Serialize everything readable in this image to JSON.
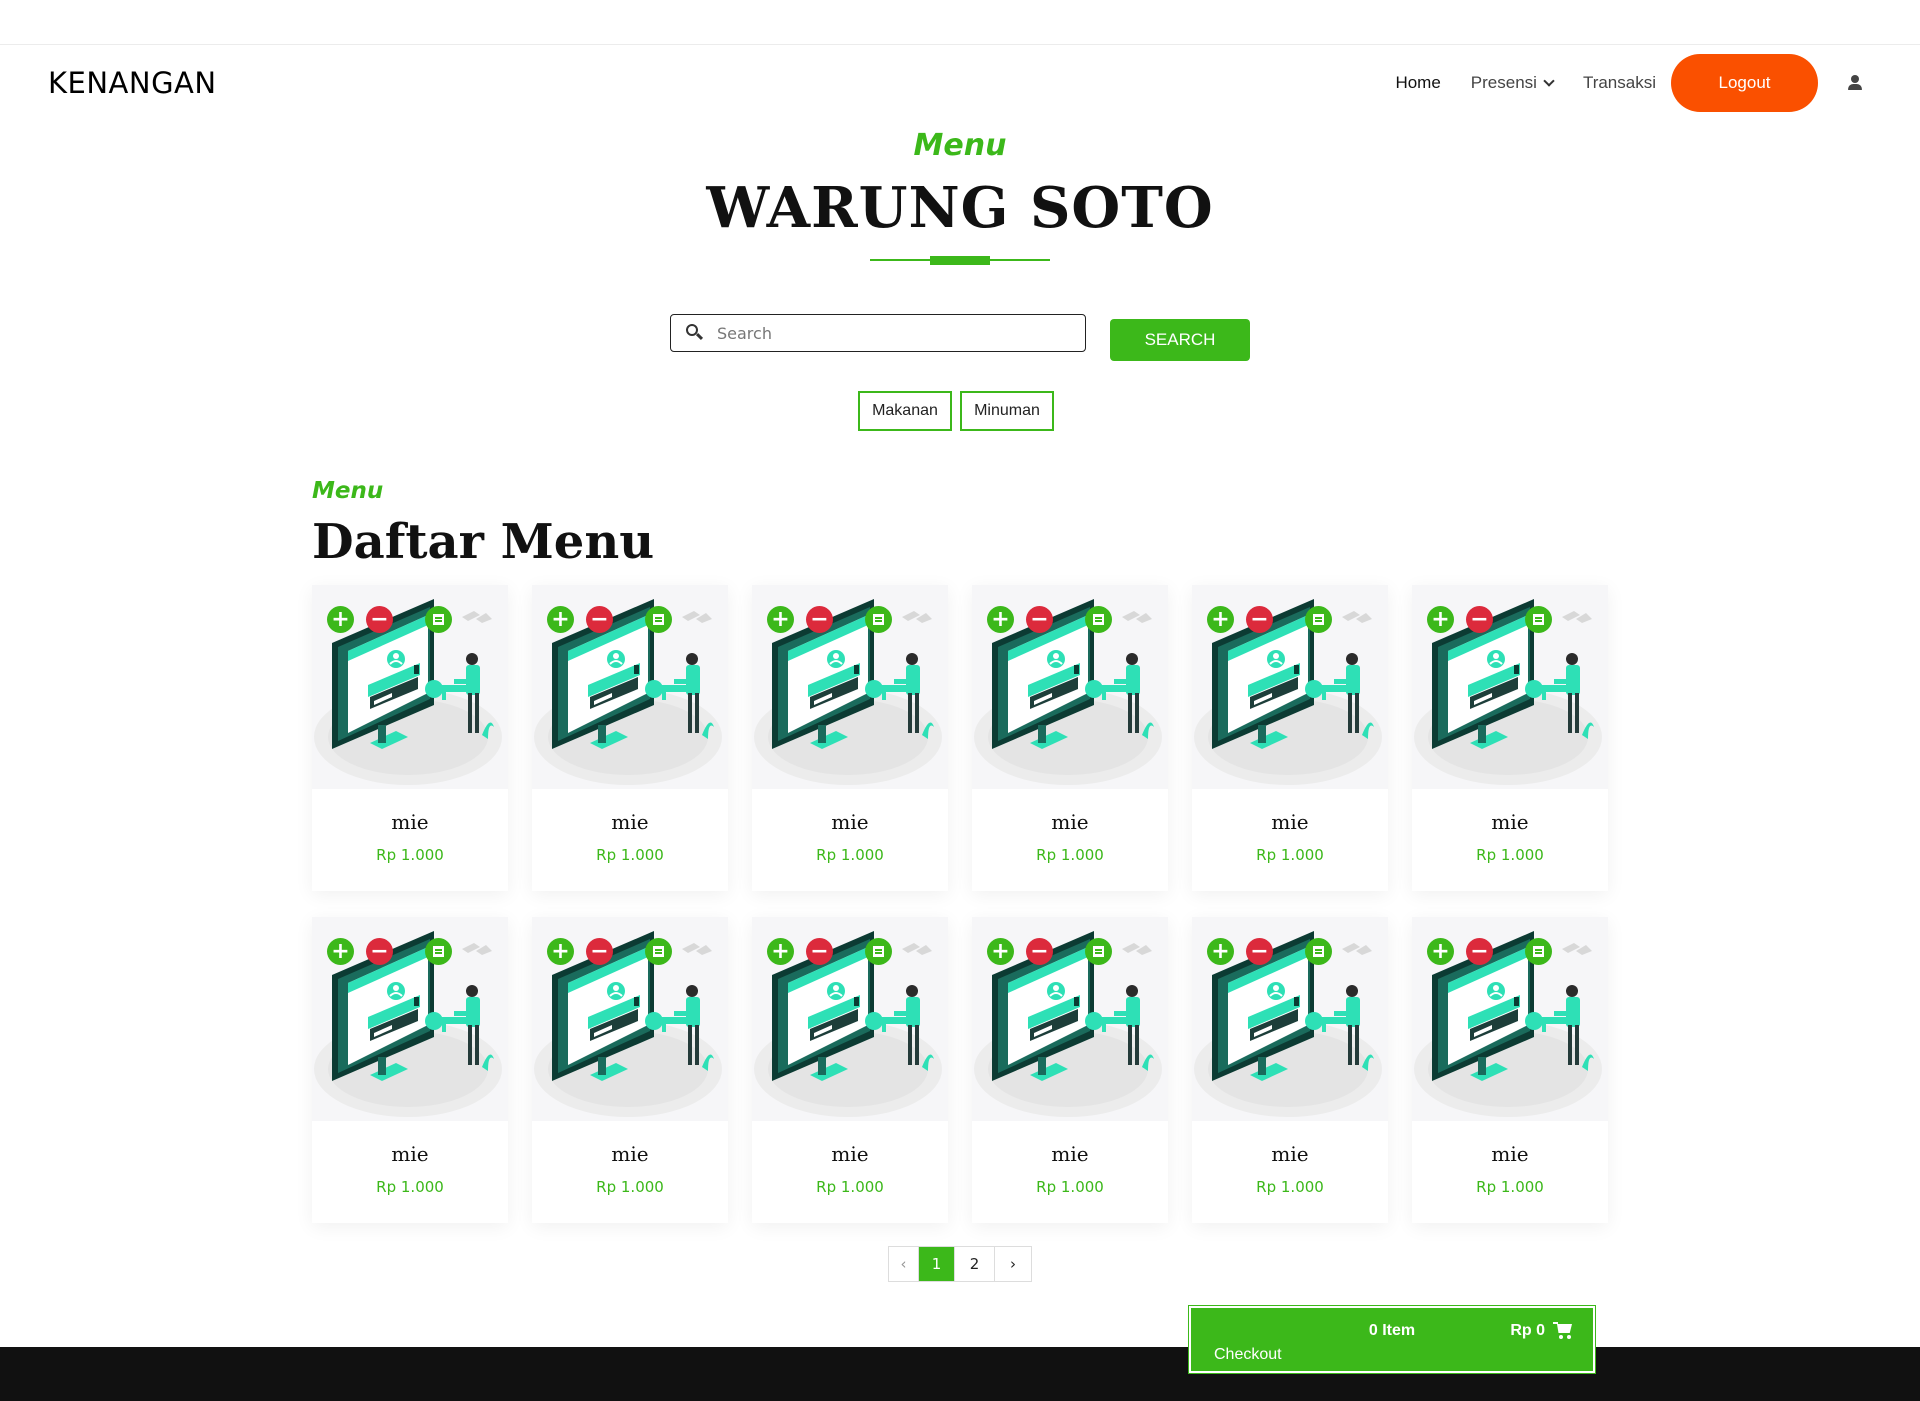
{
  "header": {
    "brand": "KENANGAN",
    "nav": [
      {
        "label": "Home",
        "active": true
      },
      {
        "label": "Presensi",
        "dropdown": true
      },
      {
        "label": "Transaksi"
      }
    ],
    "logout_label": "Logout",
    "user_icon": "user-icon"
  },
  "hero": {
    "subtitle": "Menu",
    "title": "WARUNG SOTO"
  },
  "search": {
    "placeholder": "Search",
    "value": "",
    "button_label": "SEARCH",
    "icon": "search-icon"
  },
  "categories": [
    "Makanan",
    "Minuman"
  ],
  "section": {
    "subtitle": "Menu",
    "title": "Daftar Menu"
  },
  "menu_items": [
    {
      "name": "mie",
      "price": "Rp 1.000"
    },
    {
      "name": "mie",
      "price": "Rp 1.000"
    },
    {
      "name": "mie",
      "price": "Rp 1.000"
    },
    {
      "name": "mie",
      "price": "Rp 1.000"
    },
    {
      "name": "mie",
      "price": "Rp 1.000"
    },
    {
      "name": "mie",
      "price": "Rp 1.000"
    },
    {
      "name": "mie",
      "price": "Rp 1.000"
    },
    {
      "name": "mie",
      "price": "Rp 1.000"
    },
    {
      "name": "mie",
      "price": "Rp 1.000"
    },
    {
      "name": "mie",
      "price": "Rp 1.000"
    },
    {
      "name": "mie",
      "price": "Rp 1.000"
    },
    {
      "name": "mie",
      "price": "Rp 1.000"
    }
  ],
  "card_actions": {
    "plus_icon": "plus-icon",
    "minus_icon": "minus-icon",
    "detail_icon": "detail-icon"
  },
  "pagination": {
    "prev": "‹",
    "pages": [
      "1",
      "2"
    ],
    "current": "1",
    "next": "›"
  },
  "checkout": {
    "items": "0 Item",
    "total": "Rp 0",
    "label": "Checkout",
    "icon": "cart-icon"
  },
  "colors": {
    "accent": "#3cb81a",
    "logout": "#fa5000",
    "minus": "#dc2a3c",
    "footer": "#111111"
  }
}
